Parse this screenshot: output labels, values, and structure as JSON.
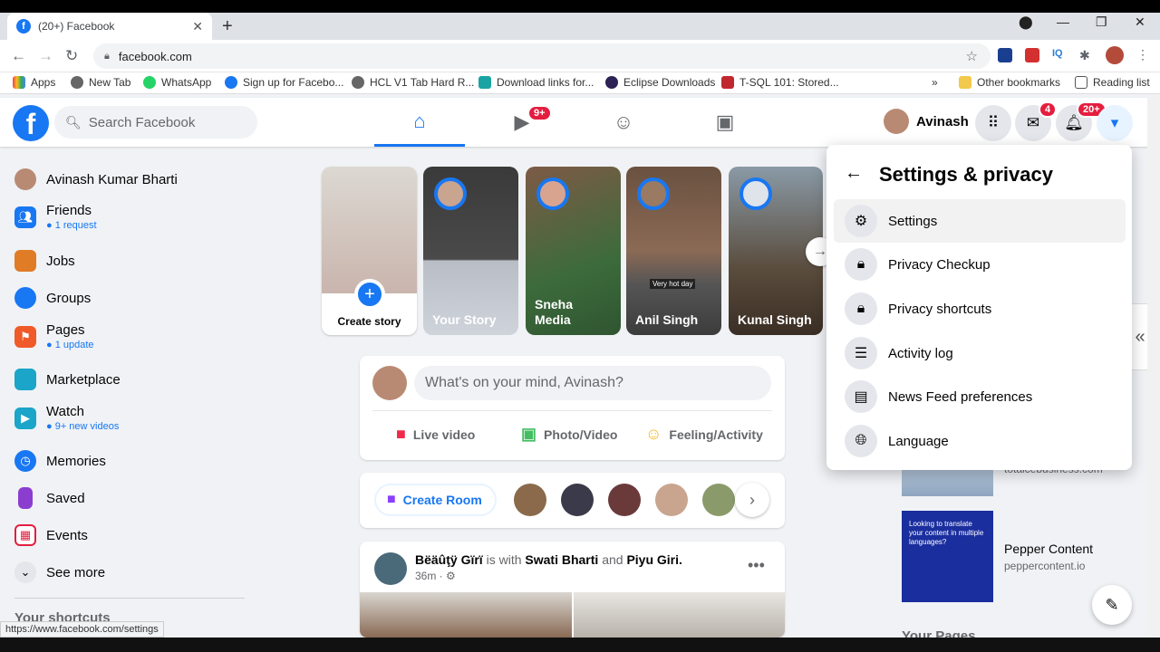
{
  "browser": {
    "tab_title": "(20+) Facebook",
    "url": "facebook.com",
    "bookmarks": [
      "Apps",
      "New Tab",
      "WhatsApp",
      "Sign up for Facebo...",
      "HCL V1 Tab Hard R...",
      "Download links for...",
      "Eclipse Downloads",
      "T-SQL 101: Stored..."
    ],
    "other_bookmarks": "Other bookmarks",
    "reading_list": "Reading list",
    "status_url": "https://www.facebook.com/settings"
  },
  "header": {
    "search_placeholder": "Search Facebook",
    "watch_badge": "9+",
    "profile_name": "Avinash",
    "messenger_badge": "4",
    "notif_badge": "20+"
  },
  "sidebar": {
    "user": "Avinash Kumar Bharti",
    "items": [
      {
        "label": "Friends",
        "sub": "1 request",
        "color": "#1877f2"
      },
      {
        "label": "Jobs",
        "sub": "",
        "color": "#e07b26"
      },
      {
        "label": "Groups",
        "sub": "",
        "color": "#1877f2"
      },
      {
        "label": "Pages",
        "sub": "1 update",
        "color": "#f05a28"
      },
      {
        "label": "Marketplace",
        "sub": "",
        "color": "#1aa5c9"
      },
      {
        "label": "Watch",
        "sub": "9+ new videos",
        "color": "#1aa5c9"
      },
      {
        "label": "Memories",
        "sub": "",
        "color": "#1877f2"
      },
      {
        "label": "Saved",
        "sub": "",
        "color": "#8b3dcf"
      },
      {
        "label": "Events",
        "sub": "",
        "color": "#e41e3f"
      }
    ],
    "see_more": "See more",
    "shortcuts": "Your shortcuts"
  },
  "stories": {
    "create": "Create story",
    "names": [
      "Your Story",
      "Sneha Media",
      "Anil Singh",
      "Kunal Singh"
    ],
    "anil_caption": "Very hot day"
  },
  "composer": {
    "placeholder": "What's on your mind, Avinash?",
    "live": "Live video",
    "photo": "Photo/Video",
    "feeling": "Feeling/Activity"
  },
  "rooms": {
    "create_room": "Create Room"
  },
  "post": {
    "author": "Bëäûţÿ Gïrï",
    "with_text": "is with",
    "tag1": "Swati Bharti",
    "and_text": "and",
    "tag2": "Piyu Giri.",
    "time": "36m ·"
  },
  "menu": {
    "title": "Settings & privacy",
    "items": [
      "Settings",
      "Privacy Checkup",
      "Privacy shortcuts",
      "Activity log",
      "News Feed preferences",
      "Language"
    ]
  },
  "right": {
    "ad_domain_partial": "totalcebusiness.com",
    "ad_title": "Pepper Content",
    "ad_domain": "peppercontent.io",
    "ad_image_text": "Looking to translate your content in multiple languages?",
    "your_pages": "Your Pages"
  }
}
